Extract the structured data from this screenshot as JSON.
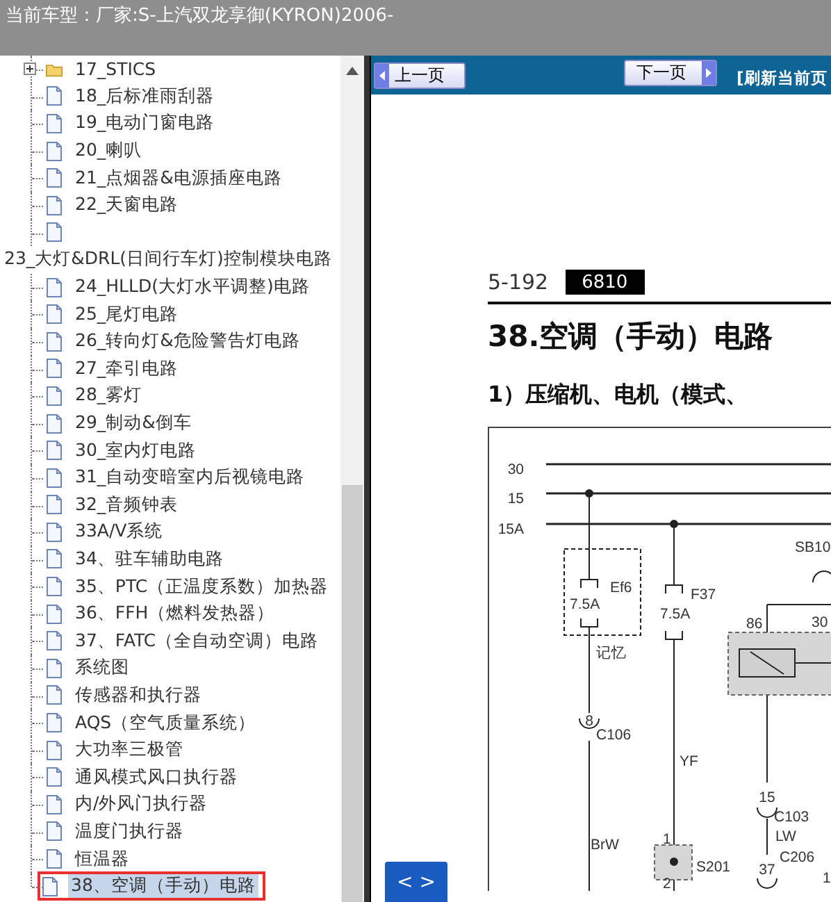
{
  "header": {
    "label": "当前车型：",
    "value": "厂家:S-上汽双龙享御(KYRON)2006-"
  },
  "tree": {
    "items": [
      {
        "kind": "folder",
        "label": "17_STICS",
        "expanded": false,
        "selected": false
      },
      {
        "kind": "page",
        "label": "18_后标准雨刮器",
        "selected": false
      },
      {
        "kind": "page",
        "label": "19_电动门窗电路",
        "selected": false
      },
      {
        "kind": "page",
        "label": "20_喇叭",
        "selected": false
      },
      {
        "kind": "page",
        "label": "21_点烟器&电源插座电路",
        "selected": false
      },
      {
        "kind": "page",
        "label": "22_天窗电路",
        "selected": false
      },
      {
        "kind": "page",
        "selected": false
      },
      {
        "kind": "text",
        "label": "23_大灯&DRL(日间行车灯)控制模块电路",
        "selected": false
      },
      {
        "kind": "page",
        "label": "24_HLLD(大灯水平调整)电路",
        "selected": false
      },
      {
        "kind": "page",
        "label": "25_尾灯电路",
        "selected": false
      },
      {
        "kind": "page",
        "label": "26_转向灯&危险警告灯电路",
        "selected": false
      },
      {
        "kind": "page",
        "label": "27_牵引电路",
        "selected": false
      },
      {
        "kind": "page",
        "label": "28_雾灯",
        "selected": false
      },
      {
        "kind": "page",
        "label": "29_制动&倒车",
        "selected": false
      },
      {
        "kind": "page",
        "label": "30_室内灯电路",
        "selected": false
      },
      {
        "kind": "page",
        "label": "31_自动变暗室内后视镜电路",
        "selected": false
      },
      {
        "kind": "page",
        "label": "32_音频钟表",
        "selected": false
      },
      {
        "kind": "page",
        "label": "33A/V系统",
        "selected": false
      },
      {
        "kind": "page",
        "label": "34、驻车辅助电路",
        "selected": false
      },
      {
        "kind": "page",
        "label": "35、PTC（正温度系数）加热器",
        "selected": false
      },
      {
        "kind": "page",
        "label": "36、FFH（燃料发热器）",
        "selected": false
      },
      {
        "kind": "page",
        "label": "37、FATC（全自动空调）电路",
        "selected": false
      },
      {
        "kind": "page",
        "label": "系统图",
        "selected": false
      },
      {
        "kind": "page",
        "label": "传感器和执行器",
        "selected": false
      },
      {
        "kind": "page",
        "label": "AQS（空气质量系统）",
        "selected": false
      },
      {
        "kind": "page",
        "label": "大功率三极管",
        "selected": false
      },
      {
        "kind": "page",
        "label": "通风模式风口执行器",
        "selected": false
      },
      {
        "kind": "page",
        "label": "内/外风门执行器",
        "selected": false
      },
      {
        "kind": "page",
        "label": "温度门执行器",
        "selected": false
      },
      {
        "kind": "page",
        "label": "恒温器",
        "selected": false
      },
      {
        "kind": "page",
        "label": "38、空调（手动）电路",
        "selected": true
      }
    ]
  },
  "toolbar": {
    "prev": "上一页",
    "next": "下一页",
    "refresh": "[刷新当前页"
  },
  "document": {
    "page_number": "5-192",
    "code": "6810",
    "title": "38.空调（手动）电路",
    "subtitle": "1）压缩机、电机（模式、",
    "diagram_labels": [
      "30",
      "15",
      "15A",
      "Ef6",
      "7.5A",
      "记忆",
      "F37",
      "7.5A",
      "SB10",
      "86",
      "30",
      "8",
      "C106",
      "YF",
      "BrW",
      "1",
      "2",
      "S201",
      "15",
      "C103",
      "LW",
      "C206",
      "37",
      "1"
    ]
  },
  "toggle_button": "< >"
}
